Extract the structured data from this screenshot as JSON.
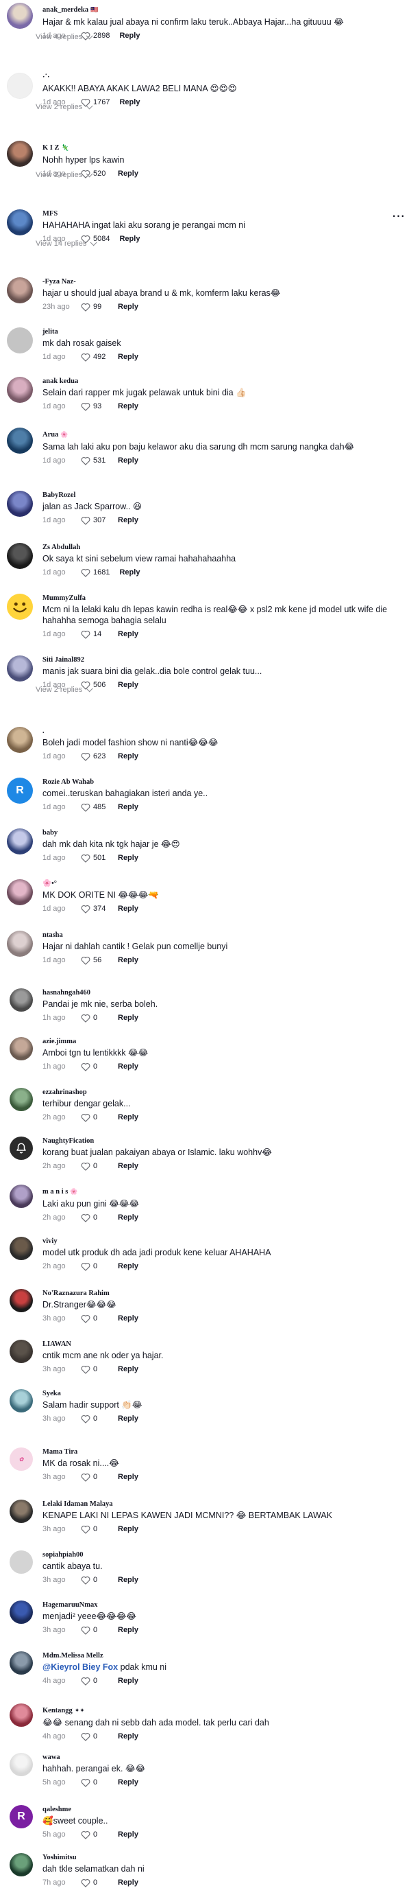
{
  "more_icon": "···",
  "reply_label": "Reply",
  "comments": [
    {
      "user": "anak_merdeka",
      "emoji": "🇲🇾",
      "text": "Hajar & mk kalau jual abaya ni confirm laku teruk..Abbaya Hajar...ha gituuuu 😂",
      "time": "1d ago",
      "likes": "2898",
      "replies": "View 4 replies",
      "avatar": "photo",
      "c1": "#7b6aa8",
      "c2": "#e4d7c8"
    },
    {
      "user": "·˙·",
      "text": "AKAKK!! ABAYA AKAK LAWA2 BELI MANA 😍😍😍",
      "time": "1d ago",
      "likes": "1767",
      "replies": "View 2 replies",
      "avatar": "blank",
      "c1": "#f0f0f0",
      "c2": "#e8e8e8"
    },
    {
      "user": "K I Z",
      "emoji": "🦎",
      "text": "Nohh hyper lps kawin",
      "time": "1d ago",
      "likes": "520",
      "replies": "View 2 replies",
      "avatar": "photo",
      "c1": "#3a2d2a",
      "c2": "#b9826a"
    },
    {
      "user": "MFS",
      "text": "HAHAHAHA ingat laki aku sorang je perangai mcm ni",
      "time": "1d ago",
      "likes": "5084",
      "replies": "View 14 replies",
      "avatar": "photo",
      "c1": "#1f3c6e",
      "c2": "#5c88c8"
    },
    {
      "user": "-Fyza Naz-",
      "text": "hajar u should jual abaya brand u & mk, komferm laku keras😂",
      "time": "23h ago",
      "likes": "99",
      "avatar": "photo",
      "c1": "#6a5350",
      "c2": "#c8a49a"
    },
    {
      "user": "jelita",
      "text": "mk dah rosak gaisek",
      "time": "1d ago",
      "likes": "492",
      "avatar": "grey",
      "c1": "#c4c4c4",
      "c2": "#b0b0b0"
    },
    {
      "user": "anak kedua",
      "text": "Selain dari rapper mk jugak pelawak untuk bini dia 👍🏻",
      "time": "1d ago",
      "likes": "93",
      "avatar": "photo",
      "c1": "#7a5a68",
      "c2": "#d8aec0"
    },
    {
      "user": "Arua",
      "emoji": "🌸",
      "text": "Sama lah laki aku pon baju kelawor aku dia sarung dh mcm sarung nangka dah😂",
      "time": "1d ago",
      "likes": "531",
      "avatar": "photo",
      "c1": "#173a5e",
      "c2": "#4e7ea8"
    },
    {
      "user": "BabyRozel",
      "text": "jalan as Jack Sparrow.. 😆",
      "time": "1d ago",
      "likes": "307",
      "avatar": "photo",
      "c1": "#2a2f6a",
      "c2": "#7a86c8"
    },
    {
      "user": "Zs Abdullah",
      "text": "Ok saya kt sini sebelum view ramai hahahahaahha",
      "time": "1d ago",
      "likes": "1681",
      "avatar": "photo",
      "c1": "#1a1a1a",
      "c2": "#555555"
    },
    {
      "user": "MummyZulfa",
      "text": "Mcm ni la lelaki kalu dh lepas kawin redha is real😂😂 x psl2 mk kene jd model utk wife die hahahha semoga bahagia selalu",
      "time": "1d ago",
      "likes": "14",
      "avatar": "smiley",
      "c1": "#ffd43b",
      "c2": "#f2b705"
    },
    {
      "user": "Siti Jainal892",
      "text": "manis jak suara bini dia gelak..dia bole control gelak tuu...",
      "time": "1d ago",
      "likes": "506",
      "replies": "View 2 replies",
      "avatar": "photo",
      "c1": "#4b4f7a",
      "c2": "#b6b8d8"
    },
    {
      "user": ".",
      "text": "Boleh jadi model fashion show ni nanti😂😂😂",
      "time": "1d ago",
      "likes": "623",
      "avatar": "photo",
      "c1": "#7a6248",
      "c2": "#cfb594"
    },
    {
      "user": "Rozie Ab Wahab",
      "text": "comei..teruskan bahagiakan isteri anda ye..",
      "time": "1d ago",
      "likes": "485",
      "avatar": "letter",
      "letter": "R",
      "c1": "#1e88e5",
      "c2": "#1e88e5"
    },
    {
      "user": "baby",
      "text": "dah mk dah kita nk tgk hajar je 😂😍",
      "time": "1d ago",
      "likes": "501",
      "avatar": "photo",
      "c1": "#2d3f76",
      "c2": "#c4c9e8"
    },
    {
      "user": "🌸•°",
      "text": "MK DOK ORITE NI 😂😂😂🔫",
      "time": "1d ago",
      "likes": "374",
      "avatar": "photo",
      "c1": "#6b4a5a",
      "c2": "#e2b6c8"
    },
    {
      "user": "ntasha",
      "text": "Hajar ni dahlah cantik ! Gelak pun comellje bunyi",
      "time": "1d ago",
      "likes": "56",
      "avatar": "photo",
      "c1": "#8a7c7c",
      "c2": "#ddd0d0"
    },
    {
      "user": "hasnahngah460",
      "text": "Pandai je mk nie, serba boleh.",
      "time": "1h ago",
      "likes": "0",
      "avatar": "photo",
      "small": true,
      "c1": "#4a4a4a",
      "c2": "#9a9a9a"
    },
    {
      "user": "azie.jimma",
      "text": "Amboi tgn tu lentikkkk 😂😂",
      "time": "1h ago",
      "likes": "0",
      "avatar": "photo",
      "small": true,
      "c1": "#6a5a50",
      "c2": "#c4a898"
    },
    {
      "user": "ezzahrinashop",
      "text": "terhibur dengar gelak...",
      "time": "2h ago",
      "likes": "0",
      "avatar": "photo",
      "small": true,
      "c1": "#3a5a3a",
      "c2": "#8ab08a"
    },
    {
      "user": "NaughtyFication",
      "text": "korang buat jualan pakaiyan abaya or Islamic. laku wohhv😂",
      "time": "2h ago",
      "likes": "0",
      "avatar": "bell",
      "small": true,
      "c1": "#2b2b2b",
      "c2": "#2b2b2b"
    },
    {
      "user": "m a n i s",
      "emoji": "🌸",
      "text": "Laki aku pun gini 😂😂😂",
      "time": "2h ago",
      "likes": "0",
      "avatar": "photo",
      "small": true,
      "c1": "#4a3a5a",
      "c2": "#b0a0c8"
    },
    {
      "user": "viviy",
      "text": "model utk produk dh ada jadi produk kene keluar AHAHAHA",
      "time": "2h ago",
      "likes": "0",
      "avatar": "photo",
      "small": true,
      "c1": "#2a2a2a",
      "c2": "#6a5a4a"
    },
    {
      "user": "No'Raznazura Rahim",
      "text": "Dr.Stranger😂😂😂",
      "time": "3h ago",
      "likes": "0",
      "avatar": "photo",
      "small": true,
      "c1": "#1a1a1a",
      "c2": "#c84040"
    },
    {
      "user": "LIAWAN",
      "text": "cntik mcm ane nk oder ya hajar.",
      "time": "3h ago",
      "likes": "0",
      "avatar": "photo",
      "small": true,
      "c1": "#3a3430",
      "c2": "#5a524a"
    },
    {
      "user": "Syeka",
      "text": "Salam hadir support 👏🏻😂",
      "time": "3h ago",
      "likes": "0",
      "avatar": "photo",
      "small": true,
      "c1": "#3a6a7a",
      "c2": "#a8d0d8"
    },
    {
      "user": "Mama Tira",
      "text": "MK da rosak ni....😂",
      "time": "3h ago",
      "likes": "0",
      "avatar": "logo",
      "small": true,
      "c1": "#e35a9a",
      "c2": "#e35a9a"
    },
    {
      "user": "Lelaki Idaman Malaya",
      "text": "KENAPE LAKI NI LEPAS KAWEN JADI MCMNI?? 😂 BERTAMBAK LAWAK",
      "time": "3h ago",
      "likes": "0",
      "avatar": "photo",
      "small": true,
      "c1": "#2a2a2a",
      "c2": "#8a7a6a"
    },
    {
      "user": "sopiahpiah00",
      "text": "cantik abaya tu.",
      "time": "3h ago",
      "likes": "0",
      "avatar": "grey",
      "small": true,
      "c1": "#d4d4d4",
      "c2": "#c4c4c4"
    },
    {
      "user": "HagemaruuNmax",
      "text": "menjadi² yeee😂😂😂😂",
      "time": "3h ago",
      "likes": "0",
      "avatar": "photo",
      "small": true,
      "c1": "#1a2a5a",
      "c2": "#3a5ab0"
    },
    {
      "user": "Mdm.Melissa Mellz",
      "mention": "@Kieyrol Biey Fox",
      "text": " pdak kmu ni",
      "time": "4h ago",
      "likes": "0",
      "avatar": "photo",
      "small": true,
      "c1": "#2a3a4a",
      "c2": "#8a9aaa"
    },
    {
      "user": "Kentangg",
      "emoji": "✦✦",
      "text": "😂😂 senang dah ni sebb dah ada model. tak perlu cari dah",
      "time": "4h ago",
      "likes": "0",
      "avatar": "photo",
      "small": true,
      "c1": "#8a2a3a",
      "c2": "#e08a9a"
    },
    {
      "user": "wawa",
      "text": "hahhah. perangai ek. 😂😂",
      "time": "5h ago",
      "likes": "0",
      "avatar": "photo",
      "small": true,
      "c1": "#d8d8d8",
      "c2": "#f4f4f4"
    },
    {
      "user": "qaleshme",
      "text": "🥰sweet couple..",
      "time": "5h ago",
      "likes": "0",
      "avatar": "letter",
      "letter": "R",
      "small": true,
      "c1": "#7b1fa2",
      "c2": "#7b1fa2"
    },
    {
      "user": "Yoshimitsu",
      "text": "dah tkle selamatkan dah ni",
      "time": "7h ago",
      "likes": "0",
      "avatar": "photo",
      "small": true,
      "c1": "#1a3a2a",
      "c2": "#6aa07a"
    }
  ]
}
